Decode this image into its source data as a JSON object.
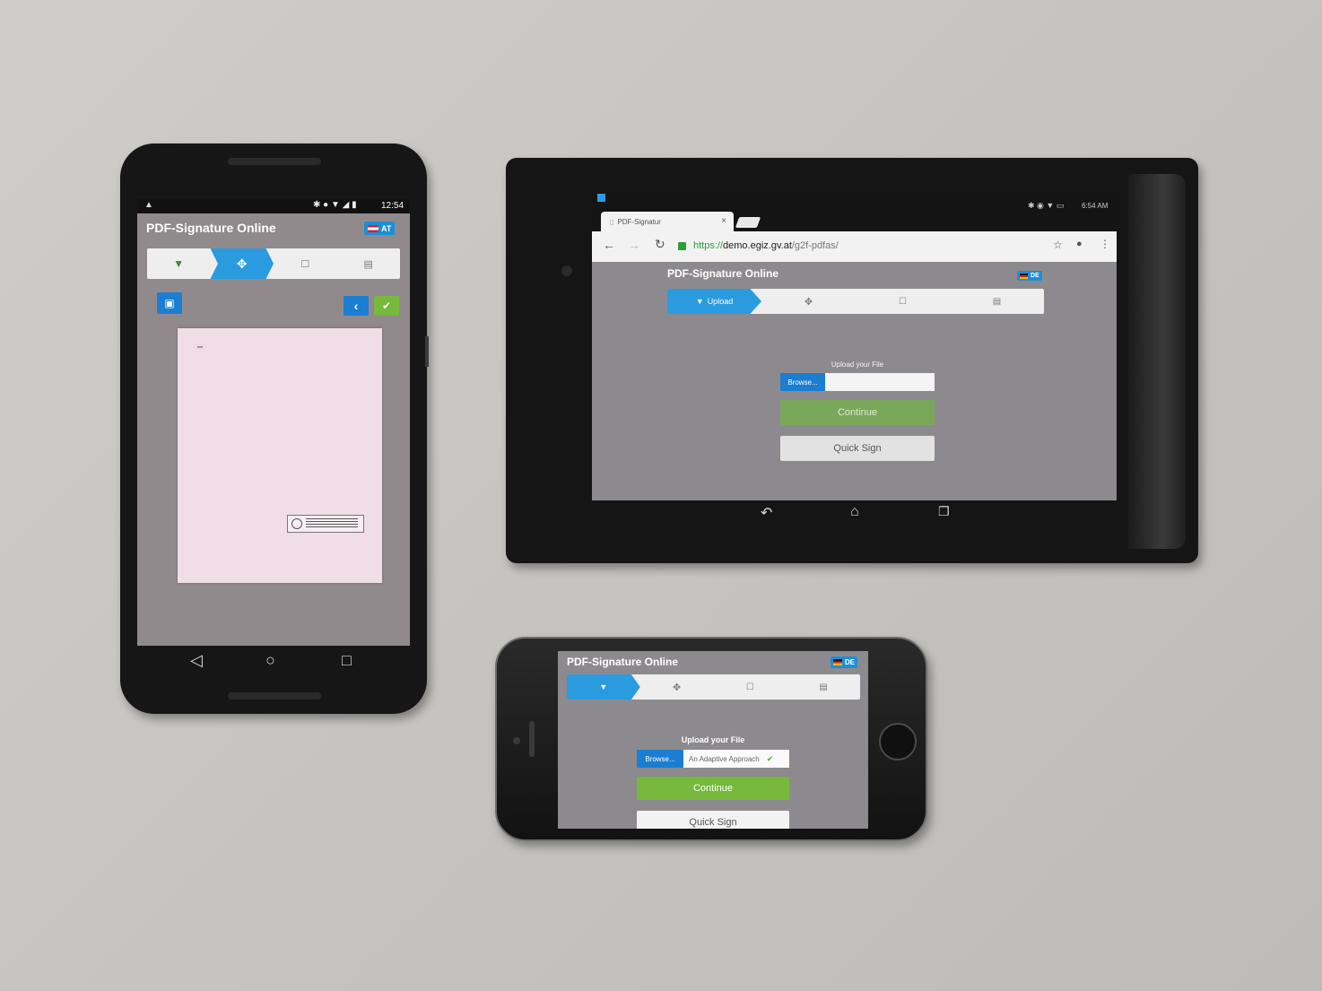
{
  "android_phone": {
    "status_time": "12:54",
    "app_title": "PDF-Signature Online",
    "lang_label": "AT",
    "icons": [
      "file-icon",
      "move-icon",
      "edit-icon",
      "sign-icon",
      "clipboard-icon",
      "chevron-left-icon",
      "check-icon",
      "back-triangle-icon",
      "home-circle-icon",
      "recents-square-icon"
    ]
  },
  "tablet": {
    "status_time": "6:54 AM",
    "tab_title": "PDF-Signatur",
    "tab_close": "×",
    "url_scheme": "https://",
    "url_host": "demo.egiz.gv.at",
    "url_path": "/g2f-pdfas/",
    "app_title": "PDF-Signature Online",
    "lang_label": "DE",
    "steps": [
      "Upload",
      "",
      "",
      ""
    ],
    "upload_label": "Upload your File",
    "browse_label": "Browse...",
    "continue_label": "Continue",
    "quick_sign_label": "Quick Sign"
  },
  "iphone": {
    "app_title": "PDF-Signature Online",
    "lang_label": "DE",
    "upload_label": "Upload your File",
    "browse_label": "Browse...",
    "file_name": "An Adaptive Approach",
    "continue_label": "Continue",
    "quick_sign_label": "Quick Sign"
  },
  "colors": {
    "accent_blue": "#2b9be0",
    "browse_blue": "#1c7ed0",
    "continue_green": "#76b93d",
    "screen_grey": "#8c8a8e"
  }
}
